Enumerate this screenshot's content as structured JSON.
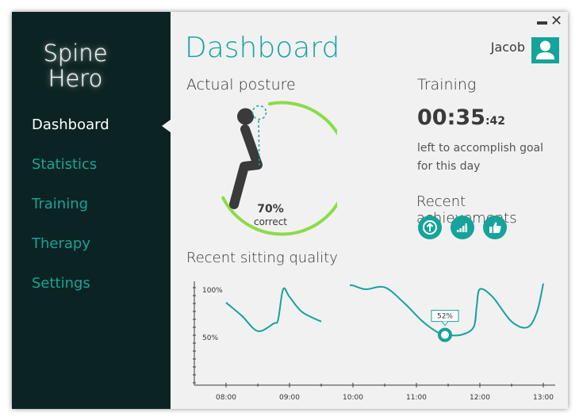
{
  "app": {
    "logo_line1": "Spine",
    "logo_line2": "Hero"
  },
  "sidebar": {
    "items": [
      {
        "label": "Dashboard",
        "active": true
      },
      {
        "label": "Statistics"
      },
      {
        "label": "Training"
      },
      {
        "label": "Therapy"
      },
      {
        "label": "Settings"
      }
    ]
  },
  "header": {
    "title": "Dashboard",
    "user_name": "Jacob",
    "avatar_icon": "user-icon"
  },
  "posture": {
    "label": "Actual posture",
    "percent_text": "70%",
    "caption": "correct",
    "percent_value": 0.7
  },
  "training": {
    "label": "Training",
    "timer_main": "00:35",
    "timer_seconds": ":42",
    "goal_line1": "left to accomplish goal",
    "goal_line2": "for this day"
  },
  "achievements": {
    "label": "Recent achievements",
    "icons": [
      "up-arrow-icon",
      "signal-bars-icon",
      "thumbs-up-icon"
    ]
  },
  "sitting": {
    "label": "Recent sitting quality",
    "tooltip": "52%"
  },
  "chart_data": {
    "type": "line",
    "ylabel_ticks": [
      "100%",
      "50%"
    ],
    "x_ticks": [
      "08:00",
      "09:00",
      "10:00",
      "11:00",
      "12:00",
      "13:00"
    ],
    "ylim": [
      0,
      110
    ],
    "series": [
      {
        "segments": [
          [
            [
              8.0,
              86
            ],
            [
              8.25,
              72
            ],
            [
              8.5,
              56
            ],
            [
              8.75,
              64
            ],
            [
              8.82,
              68
            ],
            [
              8.9,
              100
            ],
            [
              9.0,
              92
            ],
            [
              9.2,
              76
            ],
            [
              9.5,
              66
            ]
          ],
          [
            [
              9.95,
              104
            ],
            [
              10.0,
              104
            ],
            [
              10.2,
              100
            ],
            [
              10.5,
              102
            ],
            [
              10.8,
              86
            ],
            [
              11.1,
              66
            ],
            [
              11.35,
              54
            ],
            [
              11.45,
              52
            ],
            [
              11.7,
              52
            ],
            [
              11.9,
              60
            ],
            [
              11.95,
              82
            ],
            [
              12.0,
              100
            ],
            [
              12.2,
              92
            ],
            [
              12.5,
              66
            ],
            [
              12.75,
              60
            ],
            [
              12.9,
              76
            ],
            [
              13.0,
              106
            ]
          ]
        ]
      }
    ],
    "highlight": {
      "x": 11.45,
      "y": 52,
      "label": "52%"
    },
    "colors": {
      "line": "#15a39b",
      "axis": "#3a3a3a"
    },
    "grid": false
  },
  "colors": {
    "accent": "#15a39b",
    "sidebar_bg": "#0b2322",
    "gauge_green": "#8bdc45"
  }
}
